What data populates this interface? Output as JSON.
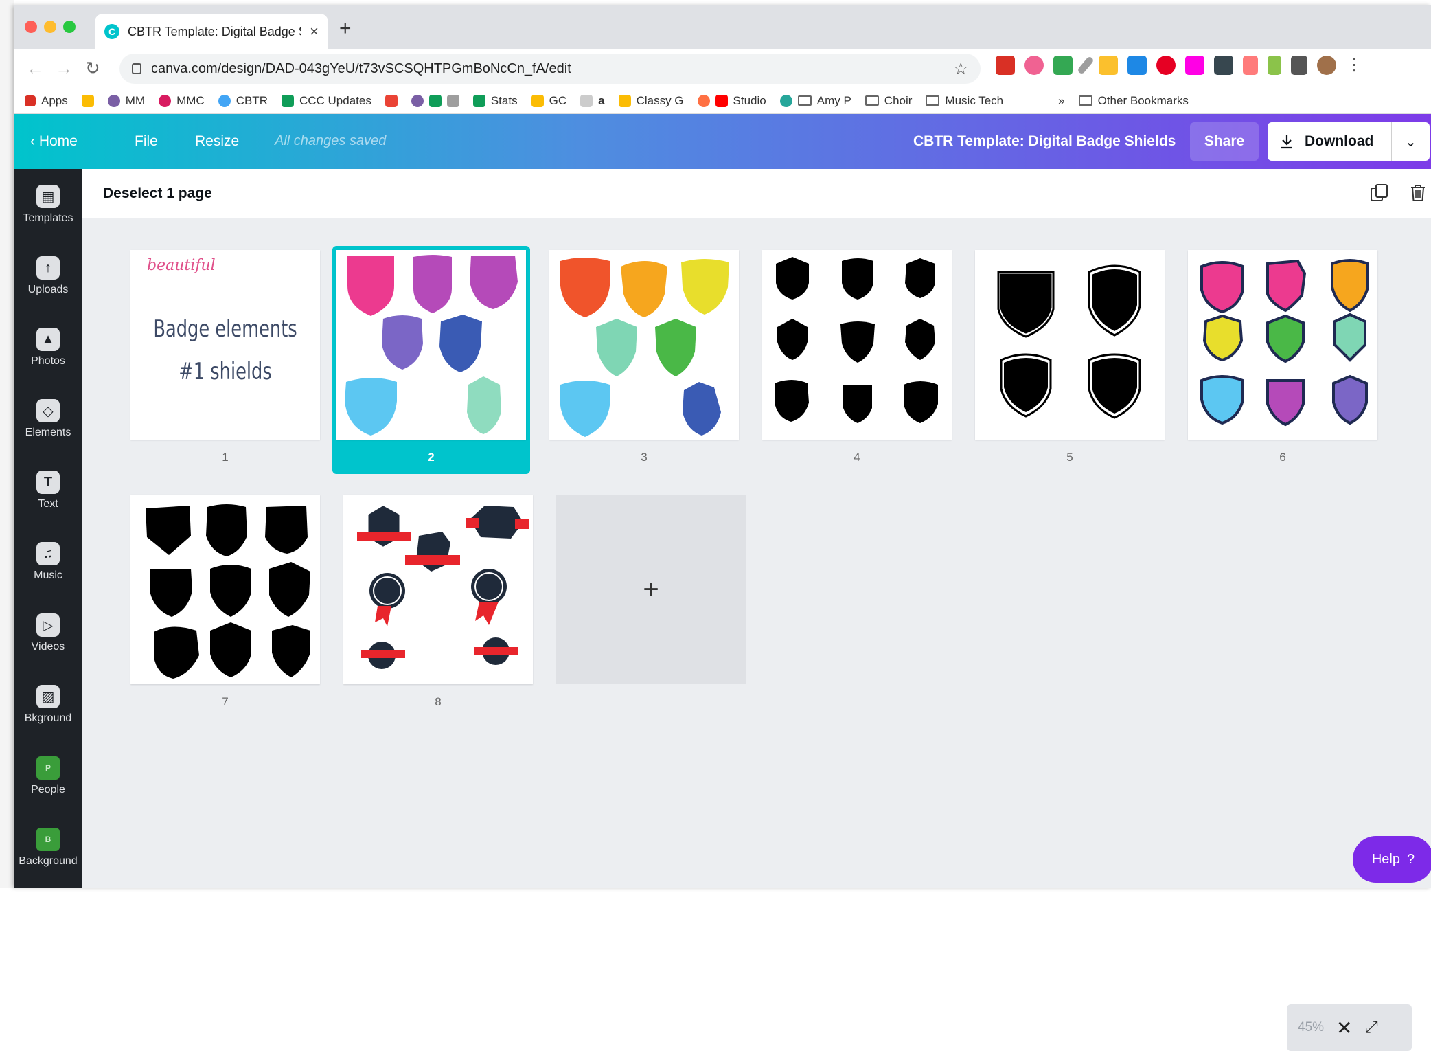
{
  "browser": {
    "tab_title": "CBTR Template: Digital Badge S",
    "tab_favicon": "C",
    "url": "canva.com/design/DAD-043gYeU/t73vSCSQHTPGmBoNcCn_fA/edit"
  },
  "bookmarks": {
    "items": [
      "Apps",
      "MM",
      "MMC",
      "CBTR",
      "CCC Updates",
      "Stats",
      "GC",
      "Classy G",
      "Studio",
      "Amy P",
      "Choir",
      "Music Tech"
    ],
    "overflow": "»",
    "other": "Other Bookmarks"
  },
  "header": {
    "home": "Home",
    "file": "File",
    "resize": "Resize",
    "saved_status": "All changes saved",
    "design_title": "CBTR Template: Digital Badge Shields",
    "share": "Share",
    "download": "Download"
  },
  "sidebar": {
    "items": [
      {
        "label": "Templates"
      },
      {
        "label": "Uploads"
      },
      {
        "label": "Photos"
      },
      {
        "label": "Elements"
      },
      {
        "label": "Text"
      },
      {
        "label": "Music"
      },
      {
        "label": "Videos"
      },
      {
        "label": "Bkground"
      },
      {
        "label": "People",
        "badge": "P"
      },
      {
        "label": "Background",
        "badge": "B"
      }
    ]
  },
  "toolbar": {
    "deselect": "Deselect 1 page"
  },
  "pages": [
    {
      "number": "1",
      "logo": "beautiful",
      "line1": "Badge elements",
      "line2": "#1 shields"
    },
    {
      "number": "2",
      "selected": true
    },
    {
      "number": "3"
    },
    {
      "number": "4"
    },
    {
      "number": "5"
    },
    {
      "number": "6"
    },
    {
      "number": "7"
    },
    {
      "number": "8"
    }
  ],
  "add_page": "+",
  "footer": {
    "zoom": "45%",
    "help": "Help",
    "help_icon": "?"
  },
  "colors": {
    "accent": "#00c4cc",
    "purple": "#7d2ae8",
    "sidebar": "#1e2227"
  }
}
